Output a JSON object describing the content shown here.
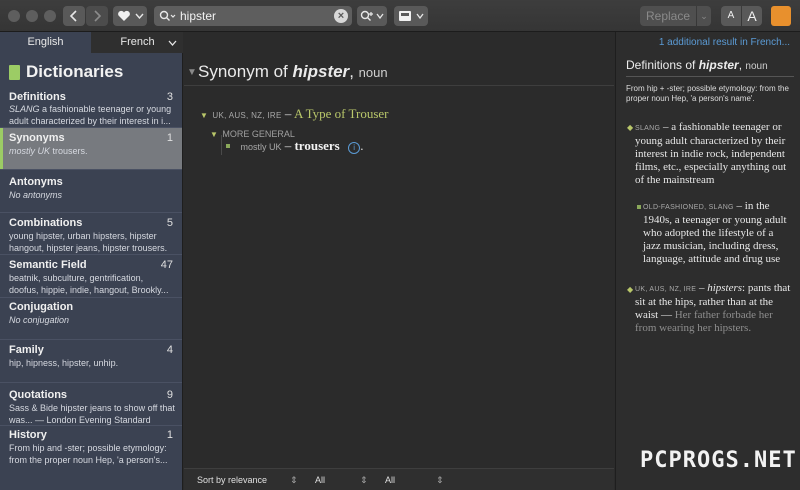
{
  "toolbar": {
    "search_value": "hipster",
    "replace_label": "Replace",
    "font_small": "A",
    "font_large": "A"
  },
  "sidebar": {
    "tabs": [
      "English",
      "French"
    ],
    "heading": "Dictionaries",
    "sections": [
      {
        "title": "Definitions",
        "count": "3",
        "desc_tag": "SLANG",
        "desc": " a fashionable teenager or young adult characterized by their interest in i..."
      },
      {
        "title": "Synonyms",
        "count": "1",
        "desc_tag": "mostly UK",
        "desc": " trousers."
      },
      {
        "title": "Antonyms",
        "count": "",
        "desc_tag": "",
        "desc": "No antonyms"
      },
      {
        "title": "Combinations",
        "count": "5",
        "desc_tag": "",
        "desc": "young hipster, urban hipsters, hipster hangout, hipster jeans, hipster trousers."
      },
      {
        "title": "Semantic Field",
        "count": "47",
        "desc_tag": "",
        "desc": "beatnik, subculture, gentrification, doofus, hippie, indie, hangout, Brookly..."
      },
      {
        "title": "Conjugation",
        "count": "",
        "desc_tag": "",
        "desc": "No conjugation"
      },
      {
        "title": "Family",
        "count": "4",
        "desc_tag": "",
        "desc": "hip, hipness, hipster, unhip."
      },
      {
        "title": "Quotations",
        "count": "9",
        "desc_tag": "",
        "desc": "Sass & Bide hipster jeans to show off that was... — London Evening Standard"
      },
      {
        "title": "History",
        "count": "1",
        "desc_tag": "",
        "desc": "From hip and -ster; possible etymology: from the proper noun Hep, 'a person's..."
      }
    ]
  },
  "center": {
    "heading_prefix": "Synonym of ",
    "heading_word": "hipster",
    "heading_sep": ", ",
    "heading_pos": "noun",
    "regions": "UK, AUS, NZ, IRE",
    "dash": " – ",
    "type_label": "A Type of Trouser",
    "more_general": "MORE GENERAL",
    "synonym_tag": "mostly UK",
    "synonym_word": "trousers",
    "synonym_end": ".",
    "sort_label": "Sort by relevance",
    "filter1": "All",
    "filter2": "All"
  },
  "right": {
    "more_results": "1 additional result in French...",
    "heading_prefix": "Definitions of ",
    "heading_word": "hipster",
    "heading_pos": "noun",
    "etymology": "From hip + -ster; possible etymology: from the proper noun Hep, 'a person's name'.",
    "def1_tag": "SLANG",
    "def1": " – a fashionable teenager or young adult characterized by their interest in indie rock, independent films, etc., especially anything out of the mainstream",
    "def2_tag": "OLD-FASHIONED, SLANG",
    "def2": " – in the 1940s, a teenager or young adult who adopted the lifestyle of a jazz musician, including dress, language, attitude and drug use",
    "def3_tag": "UK, AUS, NZ, IRE",
    "def3_word": "hipsters",
    "def3": ": pants that sit at the hips, rather than at the waist — ",
    "def3_example": "Her father forbade her from wearing her hipsters."
  },
  "watermark": "PCPROGS.NET"
}
